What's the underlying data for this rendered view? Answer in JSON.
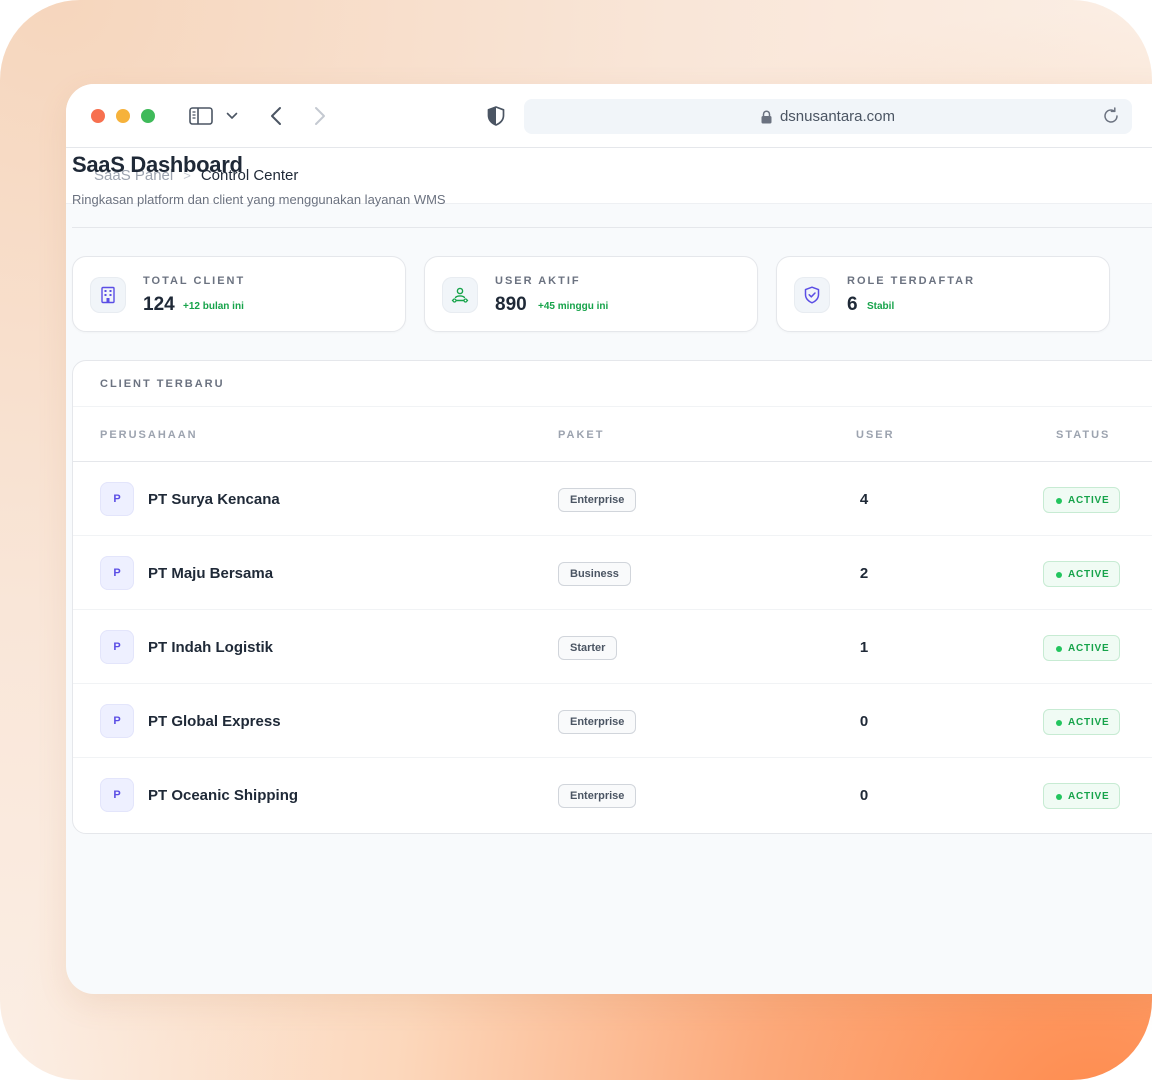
{
  "browser": {
    "url": "dsnusantara.com"
  },
  "breadcrumb": {
    "root": "SaaS Panel",
    "separator": ">",
    "current": "Control Center"
  },
  "page": {
    "title": "SaaS Dashboard",
    "subtitle": "Ringkasan platform dan client yang menggunakan layanan WMS"
  },
  "stats": [
    {
      "label": "TOTAL CLIENT",
      "value": "124",
      "delta": "+12 bulan ini",
      "icon": "building-icon"
    },
    {
      "label": "USER AKTIF",
      "value": "890",
      "delta": "+45 minggu ini",
      "icon": "users-icon"
    },
    {
      "label": "ROLE TERDAFTAR",
      "value": "6",
      "delta": "Stabil",
      "icon": "shield-check-icon"
    }
  ],
  "clients": {
    "title": "CLIENT TERBARU",
    "columns": {
      "company": "PERUSAHAAN",
      "plan": "PAKET",
      "user": "USER",
      "status": "STATUS"
    },
    "rows": [
      {
        "avatar": "P",
        "company": "PT Surya Kencana",
        "plan": "Enterprise",
        "users": "4",
        "status": "ACTIVE"
      },
      {
        "avatar": "P",
        "company": "PT Maju Bersama",
        "plan": "Business",
        "users": "2",
        "status": "ACTIVE"
      },
      {
        "avatar": "P",
        "company": "PT Indah Logistik",
        "plan": "Starter",
        "users": "1",
        "status": "ACTIVE"
      },
      {
        "avatar": "P",
        "company": "PT Global Express",
        "plan": "Enterprise",
        "users": "0",
        "status": "ACTIVE"
      },
      {
        "avatar": "P",
        "company": "PT Oceanic Shipping",
        "plan": "Enterprise",
        "users": "0",
        "status": "ACTIVE"
      }
    ]
  },
  "colors": {
    "accent": "#5b4ee5",
    "positive": "#16a34a",
    "window_close": "#f7704f",
    "window_minimize": "#f6b23b",
    "window_zoom": "#3fba5a"
  }
}
